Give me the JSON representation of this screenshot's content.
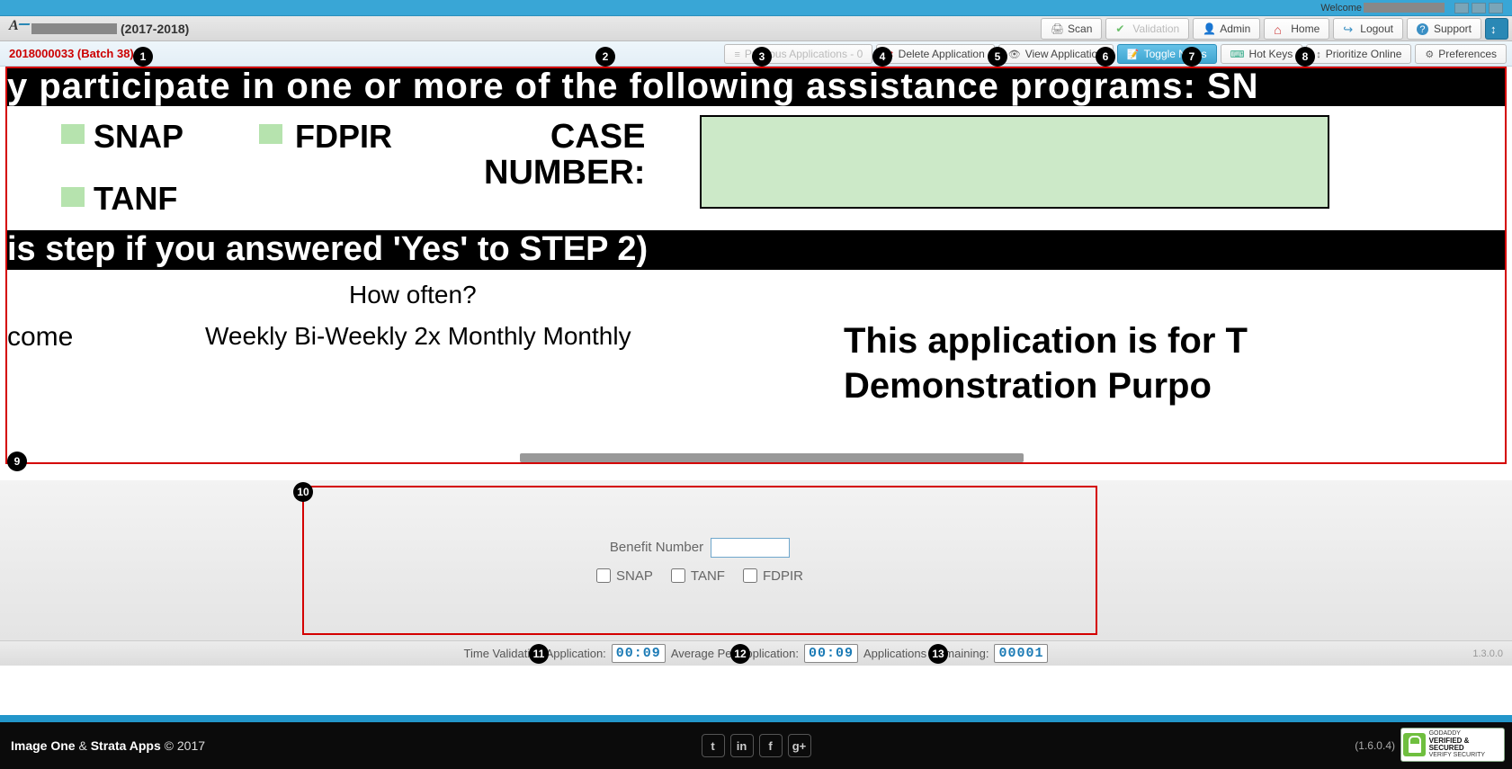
{
  "topbar": {
    "welcome": "Welcome"
  },
  "header": {
    "year": "(2017-2018)",
    "nav": {
      "scan": "Scan",
      "validation": "Validation",
      "admin": "Admin",
      "home": "Home",
      "logout": "Logout",
      "support": "Support"
    }
  },
  "toolbar": {
    "appid": "2018000033 (Batch 38)",
    "previous": "Previous Applications - 0",
    "delete": "Delete Application",
    "view": "View Application",
    "toggle": "Toggle Notes",
    "hotkeys": "Hot Keys",
    "prioritize": "Prioritize Online",
    "preferences": "Preferences"
  },
  "markers": {
    "m1": "1",
    "m2": "2",
    "m3": "3",
    "m4": "4",
    "m5": "5",
    "m6": "6",
    "m7": "7",
    "m8": "8",
    "m9": "9",
    "m10": "10",
    "m11": "11",
    "m12": "12",
    "m13": "13"
  },
  "doc": {
    "band1": "y participate in one or more of the following assistance programs: SN",
    "snap": "SNAP",
    "fdpir": "FDPIR",
    "tanf": "TANF",
    "case_lbl1": "CASE",
    "case_lbl2": "NUMBER:",
    "band2": "is step if you answered 'Yes' to STEP 2)",
    "howoften": "How often?",
    "come": "come",
    "freqs": "Weekly    Bi-Weekly  2x Monthly    Monthly",
    "demo1": "This application is for T",
    "demo2": "Demonstration Purpo"
  },
  "form": {
    "benefit_label": "Benefit Number",
    "snap": "SNAP",
    "tanf": "TANF",
    "fdpir": "FDPIR"
  },
  "status": {
    "time_label": "Time Validating Application:",
    "time_value": "00:09",
    "avg_label": "Average Per Application:",
    "avg_value": "00:09",
    "remain_label": "Applications Remaining:",
    "remain_value": "00001",
    "ver_right": "1.3.0.0"
  },
  "footer": {
    "brand_a": "Image One",
    "brand_amp": " & ",
    "brand_b": "Strata Apps",
    "copyright": " © 2017",
    "social": {
      "tw": "t",
      "li": "in",
      "fb": "f",
      "gp": "g+"
    },
    "ver": "(1.6.0.4)",
    "seal_top": "GODADDY",
    "seal_main": "VERIFIED & SECURED",
    "seal_sub": "VERIFY SECURITY"
  }
}
